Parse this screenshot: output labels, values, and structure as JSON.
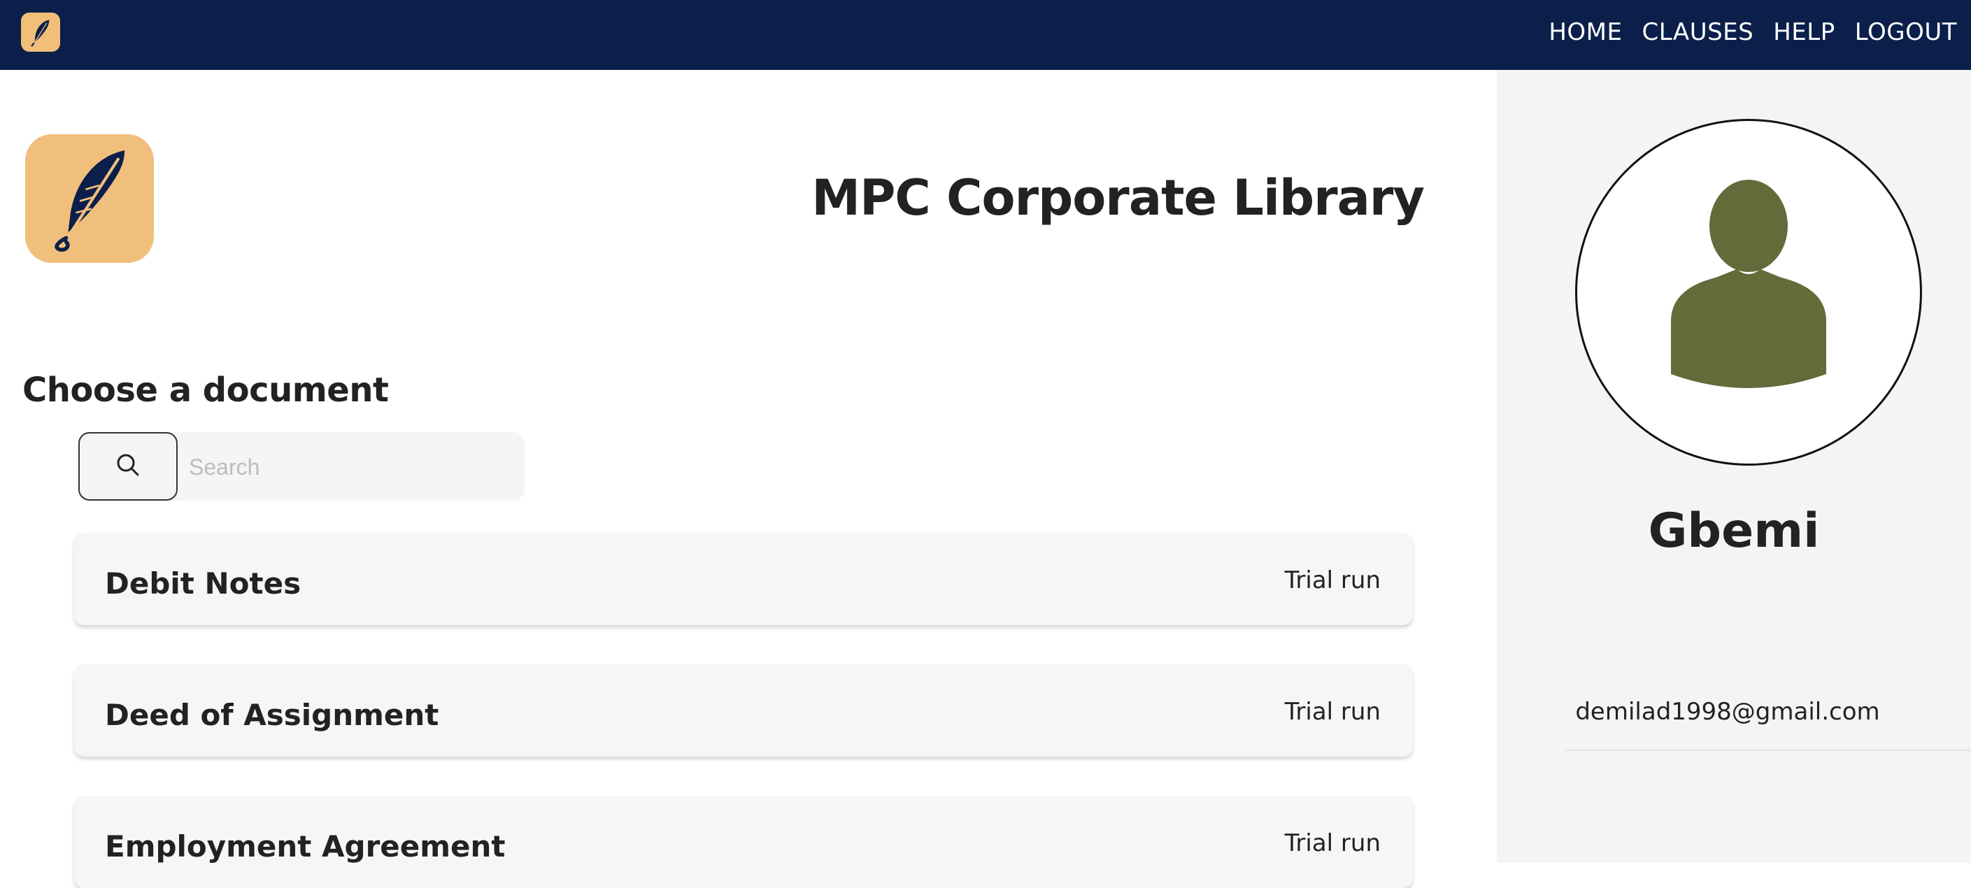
{
  "app": {
    "logo_icon": "feather-quill-icon",
    "brand_color": "#0b1f4a",
    "logo_background": "#f1bf7c"
  },
  "nav": {
    "items": [
      {
        "label": "HOME"
      },
      {
        "label": "CLAUSES"
      },
      {
        "label": "HELP"
      },
      {
        "label": "LOGOUT"
      }
    ]
  },
  "main": {
    "title": "MPC Corporate Library",
    "section_heading": "Choose a document",
    "search": {
      "placeholder": "Search",
      "value": "",
      "icon": "search-icon"
    },
    "documents": [
      {
        "name": "Debit Notes",
        "status": "Trial run"
      },
      {
        "name": "Deed of Assignment",
        "status": "Trial run"
      },
      {
        "name": "Employment Agreement",
        "status": "Trial run"
      }
    ]
  },
  "profile": {
    "avatar_icon": "user-avatar-icon",
    "avatar_color": "#646b3a",
    "name": "Gbemi",
    "email": "demilad1998@gmail.com"
  }
}
